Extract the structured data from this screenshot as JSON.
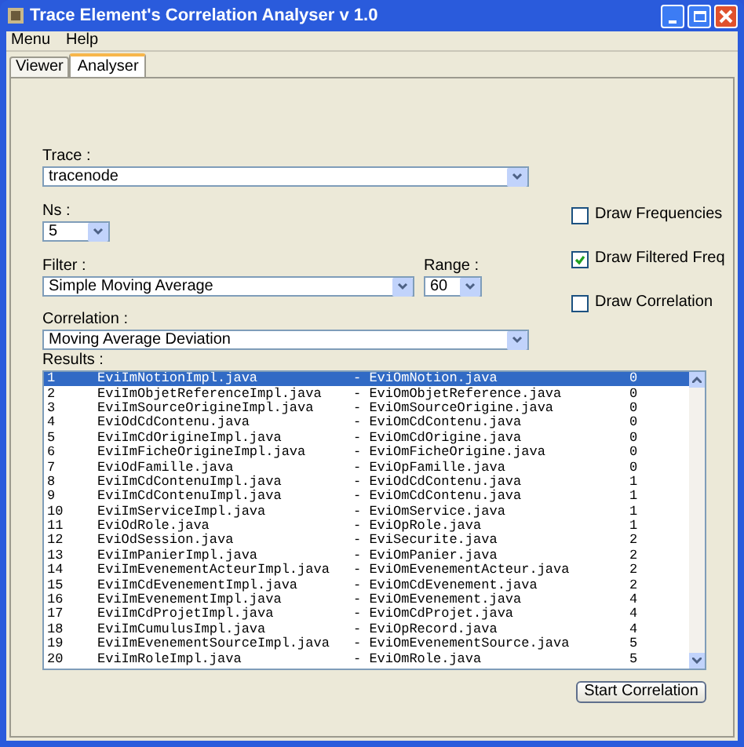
{
  "window": {
    "title": "Trace Element's Correlation Analyser  v 1.0"
  },
  "menu": [
    "Menu",
    "Help"
  ],
  "tabs": [
    {
      "label": "Viewer",
      "selected": false
    },
    {
      "label": "Analyser",
      "selected": true
    }
  ],
  "trace": {
    "label": "Trace :",
    "value": "tracenode"
  },
  "ns": {
    "label": "Ns :",
    "value": "5"
  },
  "filter": {
    "label": "Filter :",
    "value": "Simple Moving Average"
  },
  "range": {
    "label": "Range :",
    "value": "60"
  },
  "correlation": {
    "label": "Correlation :",
    "value": "Moving Average Deviation"
  },
  "options": [
    {
      "label": "Draw Frequencies",
      "checked": false
    },
    {
      "label": "Draw Filtered Freq",
      "checked": true
    },
    {
      "label": "Draw Correlation",
      "checked": false
    }
  ],
  "results": {
    "label": "Results :",
    "rows": [
      {
        "index": "1",
        "source": "EviImNotionImpl.java",
        "target": "- EviOmNotion.java",
        "score": "0",
        "selected": true
      },
      {
        "index": "2",
        "source": "EviImObjetReferenceImpl.java",
        "target": "- EviOmObjetReference.java",
        "score": "0",
        "selected": false
      },
      {
        "index": "3",
        "source": "EviImSourceOrigineImpl.java",
        "target": "- EviOmSourceOrigine.java",
        "score": "0",
        "selected": false
      },
      {
        "index": "4",
        "source": "EviOdCdContenu.java",
        "target": "- EviOmCdContenu.java",
        "score": "0",
        "selected": false
      },
      {
        "index": "5",
        "source": "EviImCdOrigineImpl.java",
        "target": "- EviOmCdOrigine.java",
        "score": "0",
        "selected": false
      },
      {
        "index": "6",
        "source": "EviImFicheOrigineImpl.java",
        "target": "- EviOmFicheOrigine.java",
        "score": "0",
        "selected": false
      },
      {
        "index": "7",
        "source": "EviOdFamille.java",
        "target": "- EviOpFamille.java",
        "score": "0",
        "selected": false
      },
      {
        "index": "8",
        "source": "EviImCdContenuImpl.java",
        "target": "- EviOdCdContenu.java",
        "score": "1",
        "selected": false
      },
      {
        "index": "9",
        "source": "EviImCdContenuImpl.java",
        "target": "- EviOmCdContenu.java",
        "score": "1",
        "selected": false
      },
      {
        "index": "10",
        "source": "EviImServiceImpl.java",
        "target": "- EviOmService.java",
        "score": "1",
        "selected": false
      },
      {
        "index": "11",
        "source": "EviOdRole.java",
        "target": "- EviOpRole.java",
        "score": "1",
        "selected": false
      },
      {
        "index": "12",
        "source": "EviOdSession.java",
        "target": "- EviSecurite.java",
        "score": "2",
        "selected": false
      },
      {
        "index": "13",
        "source": "EviImPanierImpl.java",
        "target": "- EviOmPanier.java",
        "score": "2",
        "selected": false
      },
      {
        "index": "14",
        "source": "EviImEvenementActeurImpl.java",
        "target": "- EviOmEvenementActeur.java",
        "score": "2",
        "selected": false
      },
      {
        "index": "15",
        "source": "EviImCdEvenementImpl.java",
        "target": "- EviOmCdEvenement.java",
        "score": "2",
        "selected": false
      },
      {
        "index": "16",
        "source": "EviImEvenementImpl.java",
        "target": "- EviOmEvenement.java",
        "score": "4",
        "selected": false
      },
      {
        "index": "17",
        "source": "EviImCdProjetImpl.java",
        "target": "- EviOmCdProjet.java",
        "score": "4",
        "selected": false
      },
      {
        "index": "18",
        "source": "EviImCumulusImpl.java",
        "target": "- EviOpRecord.java",
        "score": "4",
        "selected": false
      },
      {
        "index": "19",
        "source": "EviImEvenementSourceImpl.java",
        "target": "- EviOmEvenementSource.java",
        "score": "5",
        "selected": false
      },
      {
        "index": "20",
        "source": "EviImRoleImpl.java",
        "target": "- EviOmRole.java",
        "score": "5",
        "selected": false
      }
    ]
  },
  "start_button": "Start Correlation"
}
